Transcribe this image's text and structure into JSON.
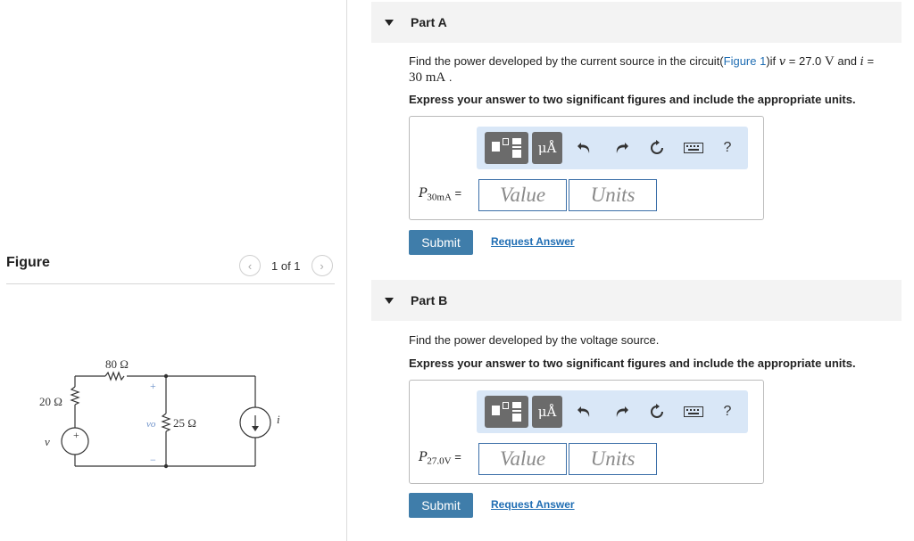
{
  "figure": {
    "title": "Figure",
    "pager_text": "1 of 1",
    "prev_icon": "chevron-left-icon",
    "next_icon": "chevron-right-icon",
    "circuit": {
      "r_left": "20 Ω",
      "r_top": "80 Ω",
      "r_mid": "25 Ω",
      "v_source": "v",
      "v_o": "vo",
      "i_source": "i",
      "plus": "+",
      "minus": "−"
    }
  },
  "partA": {
    "title": "Part A",
    "question_pre": "Find the power developed by the current source in the circuit(",
    "figure_link": "Figure 1",
    "question_mid": ")if ",
    "v_var": "v",
    "v_eq": " = 27.0 ",
    "v_unit": "V",
    "and_text": " and ",
    "i_var": "i",
    "i_eq": " =",
    "line2_value": "30 mA",
    "line2_end": " .",
    "instructions": "Express your answer to two significant figures and include the appropriate units.",
    "var_p": "P",
    "var_sub": "30mA",
    "equals": "=",
    "value_placeholder": "Value",
    "units_placeholder": "Units",
    "submit": "Submit",
    "request": "Request Answer"
  },
  "partB": {
    "title": "Part B",
    "question": "Find the power developed by the voltage source.",
    "instructions": "Express your answer to two significant figures and include the appropriate units.",
    "var_p": "P",
    "var_sub": "27.0V",
    "equals": "=",
    "value_placeholder": "Value",
    "units_placeholder": "Units",
    "submit": "Submit",
    "request": "Request Answer"
  },
  "toolbar": {
    "units_label": "μÅ",
    "help": "?",
    "icons": [
      "templates-icon",
      "units-icon",
      "undo-icon",
      "redo-icon",
      "reset-icon",
      "keyboard-icon",
      "help-icon"
    ]
  },
  "colors": {
    "accent": "#3f7daa",
    "link": "#1f6db3",
    "toolbar_bg": "#d9e7f7",
    "header_bg": "#f3f3f3"
  }
}
